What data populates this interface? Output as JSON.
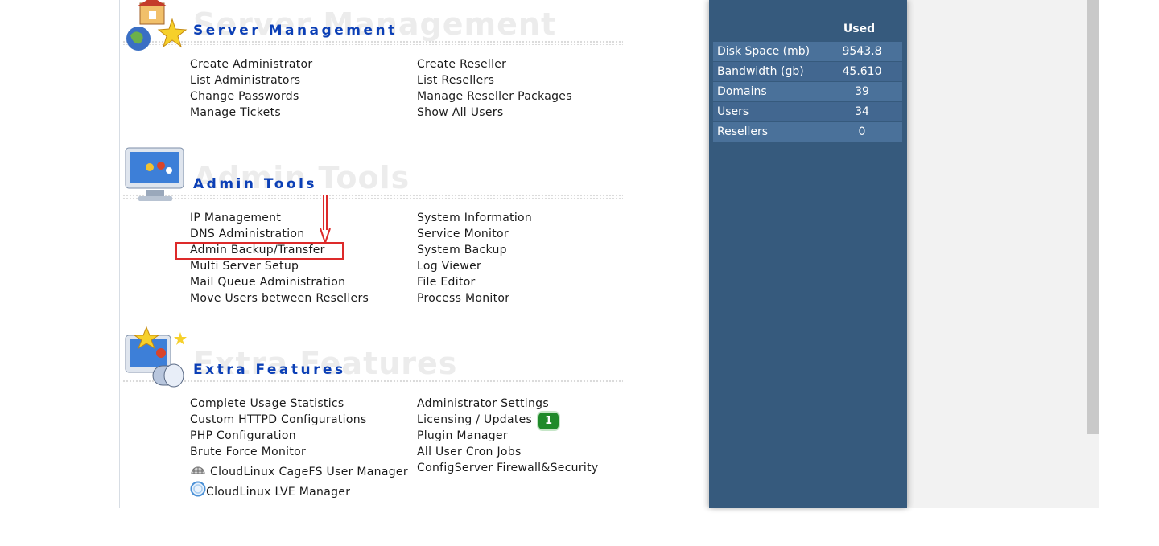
{
  "sections": {
    "server_management": {
      "title": "Server Management",
      "left_links": [
        "Create Administrator",
        "List Administrators",
        "Change Passwords",
        "Manage Tickets"
      ],
      "right_links": [
        "Create Reseller",
        "List Resellers",
        "Manage Reseller Packages",
        "Show All Users"
      ]
    },
    "admin_tools": {
      "title": "Admin Tools",
      "left_links": [
        "IP Management",
        "DNS Administration",
        "Admin Backup/Transfer",
        "Multi Server Setup",
        "Mail Queue Administration",
        "Move Users between Resellers"
      ],
      "right_links": [
        "System Information",
        "Service Monitor",
        "System Backup",
        "Log Viewer",
        "File Editor",
        "Process Monitor"
      ]
    },
    "extra_features": {
      "title": "Extra Features",
      "left_links": [
        "Complete Usage Statistics",
        "Custom HTTPD Configurations",
        "PHP Configuration",
        "Brute Force Monitor",
        "CloudLinux CageFS User Manager",
        "CloudLinux LVE Manager"
      ],
      "right_links": [
        "Administrator Settings",
        "Licensing / Updates",
        "Plugin Manager",
        "All User Cron Jobs",
        "ConfigServer Firewall&Security"
      ],
      "licensing_badge": "1"
    }
  },
  "stats": {
    "header": "Used",
    "rows": [
      {
        "label": "Disk Space (mb)",
        "value": "9543.8"
      },
      {
        "label": "Bandwidth (gb)",
        "value": "45.610"
      },
      {
        "label": "Domains",
        "value": "39"
      },
      {
        "label": "Users",
        "value": "34"
      },
      {
        "label": "Resellers",
        "value": "0"
      }
    ]
  },
  "icons": {
    "server_management": "server-management-icon",
    "admin_tools": "admin-tools-icon",
    "extra_features": "extra-features-icon",
    "cagefs": "cagefs-icon",
    "lve": "lve-icon"
  },
  "colors": {
    "title_blue": "#0b3fb6",
    "sidebar_bg": "#365a7d",
    "annotation_red": "#dd2a2a",
    "badge_green": "#1f8a2a"
  }
}
